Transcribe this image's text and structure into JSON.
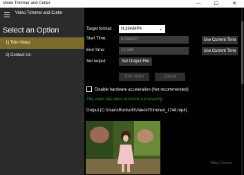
{
  "window": {
    "title": "Video Trimmer and Cutter",
    "minimize": "—",
    "maximize": "☐",
    "close": "✕"
  },
  "sidebar": {
    "app_title": "Video Trimmer and Cutter",
    "heading": "Select an Option",
    "items": [
      {
        "label": "1) Trim Video",
        "active": true
      },
      {
        "label": "2) Contact Us",
        "active": false
      }
    ]
  },
  "main": {
    "target_format_label": "Target format:",
    "target_format_value": "H.264/MP4",
    "start_time_label": "Start Time:",
    "start_time_value": "5.044427",
    "end_time_label": "End Time:",
    "end_time_value": "15.348",
    "use_current_time_1": "Use Current Time",
    "use_current_time_2": "Use Current Time",
    "set_output_label": "Set output:",
    "set_output_button": "Set Output File",
    "trim_button": "Trim Video",
    "cancel_button": "Cancel",
    "hw_accel_label": "Disable hardware acceleration (Not recommended)",
    "status_text": "The video has been trimmed successfully.",
    "output_path": "Output (C:\\Users\\Runisoft\\Videos\\Trimmed_1748.mp4)",
    "watermark": "Video Trimmer"
  },
  "colors": {
    "accent_active": "#7c6a2a",
    "success": "#2fa12f"
  }
}
